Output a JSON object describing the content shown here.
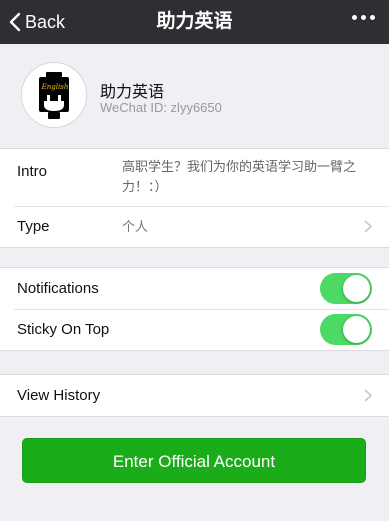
{
  "nav": {
    "back_label": "Back",
    "title": "助力英语",
    "back_icon": "chevron-left-icon",
    "more_icon": "more-dots-icon"
  },
  "profile": {
    "name": "助力英语",
    "wechat_id": "WeChat ID: zlyy6650",
    "avatar_text": "English",
    "avatar_icon": "plug-icon"
  },
  "info": {
    "intro_label": "Intro",
    "intro_line1": "高职学生？我们为你的英语学习助一臂之",
    "intro_line2": "力！：）",
    "type_label": "Type",
    "type_value": "个人"
  },
  "settings": {
    "notifications_label": "Notifications",
    "notifications_on": true,
    "sticky_label": "Sticky On Top",
    "sticky_on": true
  },
  "history": {
    "label": "View History"
  },
  "action": {
    "enter_label": "Enter Official Account"
  },
  "colors": {
    "navbar": "#2e2e33",
    "background": "#efeff4",
    "toggle_on": "#4cd964",
    "primary_button": "#1aad19"
  }
}
